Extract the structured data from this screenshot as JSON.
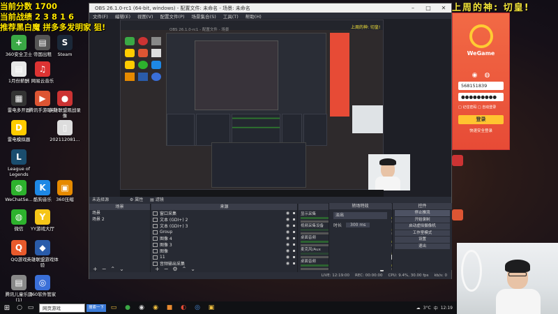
{
  "overlay": {
    "score": "当前分数 1700",
    "record": "当前战绩 2 3 8 1 6",
    "recommend": "推荐黑白魔  拼多多发明家  狙!",
    "banner": "上周的神: 切皇!"
  },
  "desktop_icons": [
    {
      "label": "360安全卫士",
      "color": "#3aa845",
      "glyph": "+"
    },
    {
      "label": "帝国出租",
      "color": "#555",
      "glyph": "▤"
    },
    {
      "label": "Steam",
      "color": "#1b2838",
      "glyph": "S"
    },
    {
      "label": "1月份薪酬",
      "color": "#e8e8e8",
      "glyph": "▤"
    },
    {
      "label": "网易云音乐",
      "color": "#d33",
      "glyph": "♫"
    },
    {
      "label": "雷电多开器",
      "color": "#333",
      "glyph": "▦"
    },
    {
      "label": "腾讯手游助手",
      "color": "#d53",
      "glyph": "▶"
    },
    {
      "label": "英雄联盟观战录像",
      "color": "#c33",
      "glyph": "●"
    },
    {
      "label": "雷电模拟器",
      "color": "#fc0",
      "glyph": "D"
    },
    {
      "label": "202112081...",
      "color": "#ddd",
      "glyph": "▯"
    },
    {
      "label": "League of Legends",
      "color": "#1a4d6e",
      "glyph": "L"
    },
    {
      "label": "WeChatSe...",
      "color": "#2db22d",
      "glyph": "◍"
    },
    {
      "label": "酷狗音乐",
      "color": "#1e88e5",
      "glyph": "K"
    },
    {
      "label": "360压缩",
      "color": "#e68a00",
      "glyph": "▣"
    },
    {
      "label": "微信",
      "color": "#2db22d",
      "glyph": "◍"
    },
    {
      "label": "YY游戏大厅",
      "color": "#f5c518",
      "glyph": "Y"
    },
    {
      "label": "QQ游戏",
      "color": "#e85a2c",
      "glyph": "Q"
    },
    {
      "label": "英雄联盟游戏体验",
      "color": "#2a5caa",
      "glyph": "◆"
    },
    {
      "label": "腾讯儿童乐园(1)",
      "color": "#888",
      "glyph": "▤"
    },
    {
      "label": "360软件管家",
      "color": "#3a6fd8",
      "glyph": "◎"
    }
  ],
  "obs": {
    "title": "OBS 26.1.0-rc1 (64-bit, windows) - 配置文件: 未命名 - 场景: 未命名",
    "menu": [
      "文件(F)",
      "编辑(E)",
      "视图(V)",
      "配置文件(P)",
      "场景集合(S)",
      "工具(T)",
      "帮助(H)"
    ],
    "scenes_header": "场景",
    "scenes": [
      "场景",
      "场景 2"
    ],
    "sources_header": "来源",
    "sources": [
      "窗口采集",
      "文本 (GDI+) 2",
      "文本 (GDI+) 3",
      "Group",
      "图像 4",
      "图像 3",
      "图像",
      "11",
      "音频输出采集"
    ],
    "mixer_header": "混音器",
    "mixer": [
      {
        "name": "显示采集",
        "db": "0.0 dB"
      },
      {
        "name": "视频采集设备",
        "db": "-26.9 dB"
      },
      {
        "name": "桌面音频",
        "db": "0.0 dB"
      },
      {
        "name": "麦克风/Aux",
        "db": "-11.8 dB"
      },
      {
        "name": "桌面音频",
        "db": "-16.0 dB"
      }
    ],
    "transitions_header": "转场特效",
    "transition": "淡出",
    "duration_label": "时长",
    "duration": "300 ms",
    "controls_header": "控件",
    "controls": [
      "停止推流",
      "开始录制",
      "启动虚拟摄像机",
      "工作室模式",
      "设置",
      "退出"
    ],
    "no_scene_label": "未选择源",
    "properties_label": "属性",
    "filters_label": "滤镜",
    "status": {
      "live": "LIVE: 12:19:00",
      "rec": "REC: 00:00:00",
      "cpu": "CPU: 9.4%, 30.00 fps",
      "kbps": "kb/s: 0"
    }
  },
  "nested": {
    "inner_title": "OBS 26.1.0-rc1 - 配置文件 - 场景",
    "inner_banner": "上周的神: 切皇!"
  },
  "wegame": {
    "brand": "WeGame",
    "account": "568151839",
    "password": "●●●●●●●●●",
    "remember": "□ 记住密码  □ 自动登录",
    "login": "登录",
    "safe_login": "快速安全登录"
  },
  "taskbar": {
    "search": "网页游戏",
    "search_btn": "搜索一下",
    "weather": "3°C",
    "input": "中",
    "clock": "12:19"
  }
}
